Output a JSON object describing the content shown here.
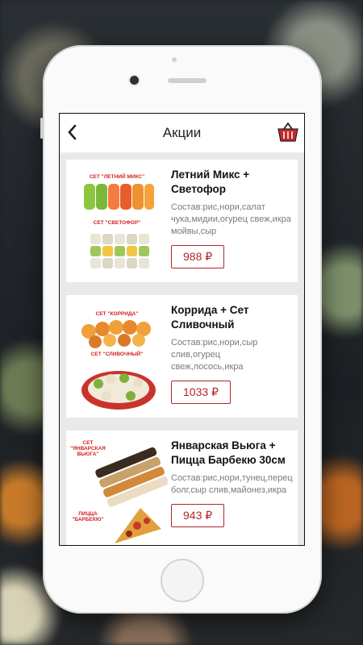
{
  "header": {
    "title": "Акции",
    "back_icon": "chevron-left-icon",
    "cart_icon": "basket-icon"
  },
  "promos": [
    {
      "name": "Летний Микс + Светофор",
      "description": "Состав:рис,нори,салат чука,мидии,огурец свеж,икра мойвы,сыр",
      "price": "988 ₽",
      "image_labels": [
        "СЕТ \"ЛЕТНИЙ МИКС\"",
        "СЕТ \"СВЕТОФОР\""
      ]
    },
    {
      "name": "Коррида + Сет Сливочный",
      "description": "Состав:рис,нори,сыр слив,огурец свеж,лосось,икра",
      "price": "1033 ₽",
      "image_labels": [
        "СЕТ \"КОРРИДА\"",
        "СЕТ \"СЛИВОЧНЫЙ\""
      ]
    },
    {
      "name": "Январская Вьюга + Пицца Барбекю 30см",
      "description": "Состав:рис,нори,тунец,перец болг,сыр слив,майонез,икра",
      "price": "943 ₽",
      "image_labels": [
        "СЕТ \"ЯНВАРСКАЯ ВЬЮГА\"",
        "ПИЦЦА \"БАРБЕКЮ\""
      ]
    }
  ],
  "colors": {
    "accent": "#b3262a",
    "label_red": "#d32020"
  }
}
